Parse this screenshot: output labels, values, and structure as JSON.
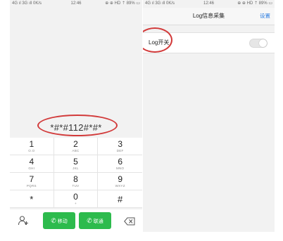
{
  "left_phone": {
    "status_bar": {
      "carrier": "4G ıl 3G ıll 0K/s ",
      "time": "12:46",
      "right_icons": "⊕ ⊕ HD ⇡ 89% ▭"
    },
    "dialed_number": "*#*#112#*#*",
    "keypad": [
      {
        "digit": "1",
        "letters": "O.O"
      },
      {
        "digit": "2",
        "letters": "ABC"
      },
      {
        "digit": "3",
        "letters": "DEF"
      },
      {
        "digit": "4",
        "letters": "GHI"
      },
      {
        "digit": "5",
        "letters": "JKL"
      },
      {
        "digit": "6",
        "letters": "MNO"
      },
      {
        "digit": "7",
        "letters": "PQRS"
      },
      {
        "digit": "8",
        "letters": "TUV"
      },
      {
        "digit": "9",
        "letters": "WXYZ"
      },
      {
        "digit": "*",
        "letters": ""
      },
      {
        "digit": "0",
        "letters": "+"
      },
      {
        "digit": "#",
        "letters": ""
      }
    ],
    "call_buttons": {
      "mobile": "移动",
      "unicom": "联通"
    }
  },
  "right_phone": {
    "status_bar": {
      "carrier": "4G ıl 3G ıll 0K/s ",
      "time": "12:46",
      "right_icons": "⊕ ⊕ HD ⇡ 89% ▭"
    },
    "title": "Log信息采集",
    "settings_link": "设置",
    "log_switch_label": "Log开关",
    "log_switch_on": false
  },
  "colors": {
    "call_green": "#2dbb4d",
    "annotation_red": "#d23a3a",
    "link_blue": "#2f7fe0"
  },
  "icons": [
    "person-add-icon",
    "phone-handset-icon",
    "backspace-icon"
  ]
}
